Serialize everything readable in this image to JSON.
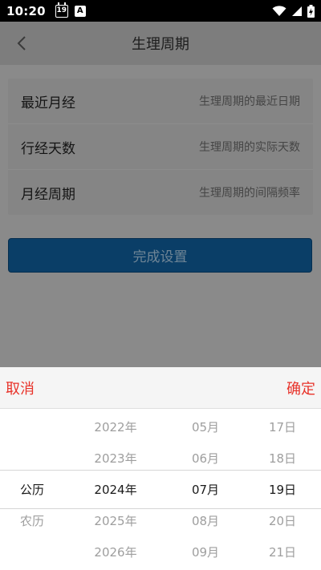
{
  "status_bar": {
    "time": "10:20",
    "calendar_day": "19",
    "notification_letter": "A"
  },
  "header": {
    "title": "生理周期"
  },
  "form": {
    "rows": [
      {
        "label": "最近月经",
        "placeholder": "生理周期的最近日期"
      },
      {
        "label": "行经天数",
        "placeholder": "生理周期的实际天数"
      },
      {
        "label": "月经周期",
        "placeholder": "生理周期的间隔频率"
      }
    ],
    "submit_label": "完成设置"
  },
  "picker": {
    "cancel_label": "取消",
    "confirm_label": "确定",
    "calendar_types": [
      "",
      "",
      "公历",
      "农历",
      ""
    ],
    "years": [
      "2022年",
      "2023年",
      "2024年",
      "2025年",
      "2026年"
    ],
    "months": [
      "05月",
      "06月",
      "07月",
      "08月",
      "09月"
    ],
    "days": [
      "17日",
      "18日",
      "19日",
      "20日",
      "21日"
    ],
    "selected_calendar_type": "公历",
    "selected_year": "2024年",
    "selected_month": "07月",
    "selected_day": "19日"
  },
  "colors": {
    "accent_red": "#e8332a",
    "button_blue": "#0a3e67",
    "overlay_gray": "#8a8a8a"
  },
  "icons": {
    "back": "chevron-left-icon",
    "wifi": "wifi-icon",
    "signal": "signal-icon",
    "battery": "battery-charging-icon",
    "calendar": "calendar-icon"
  }
}
